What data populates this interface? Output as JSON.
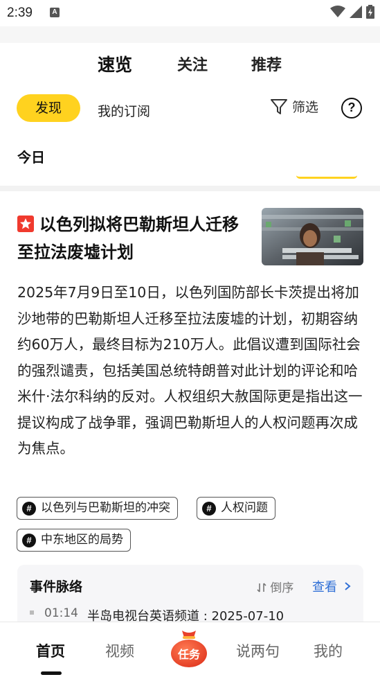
{
  "status_bar": {
    "time": "2:39",
    "notification_glyph": "A"
  },
  "top_tabs": {
    "quick": "速览",
    "follow": "关注",
    "recommend": "推荐"
  },
  "filters": {
    "discover": "发现",
    "subscriptions": "我的订阅",
    "filter": "筛选",
    "help": "?"
  },
  "section": {
    "title": "今日"
  },
  "article": {
    "title": "以色列拟将巴勒斯坦人迁移至拉法废墟计划",
    "summary": "2025年7月9日至10日，以色列国防部长卡茨提出将加沙地带的巴勒斯坦人迁移至拉法废墟的计划，初期容纳约60万人，最终目标为210万人。此倡议遭到国际社会的强烈谴责，包括美国总统特朗普对此计划的评论和哈米什·法尔科纳的反对。人权组织大赦国际更是指出这一提议构成了战争罪，强调巴勒斯坦人的人权问题再次成为焦点。",
    "tags": [
      "以色列与巴勒斯坦的冲突",
      "人权问题",
      "中东地区的局势"
    ]
  },
  "timeline": {
    "title": "事件脉络",
    "sort": "倒序",
    "view": "查看",
    "first_time": "01:14",
    "first_text": "半岛电视台英语频道 : 2025-07-10"
  },
  "bottom_nav": {
    "home": "首页",
    "video": "视频",
    "task": "任务",
    "talk": "说两句",
    "mine": "我的"
  },
  "colors": {
    "accent": "#ffd21f",
    "badge": "#f03a2e",
    "link": "#2f6fd6",
    "task": "#f0492f"
  }
}
